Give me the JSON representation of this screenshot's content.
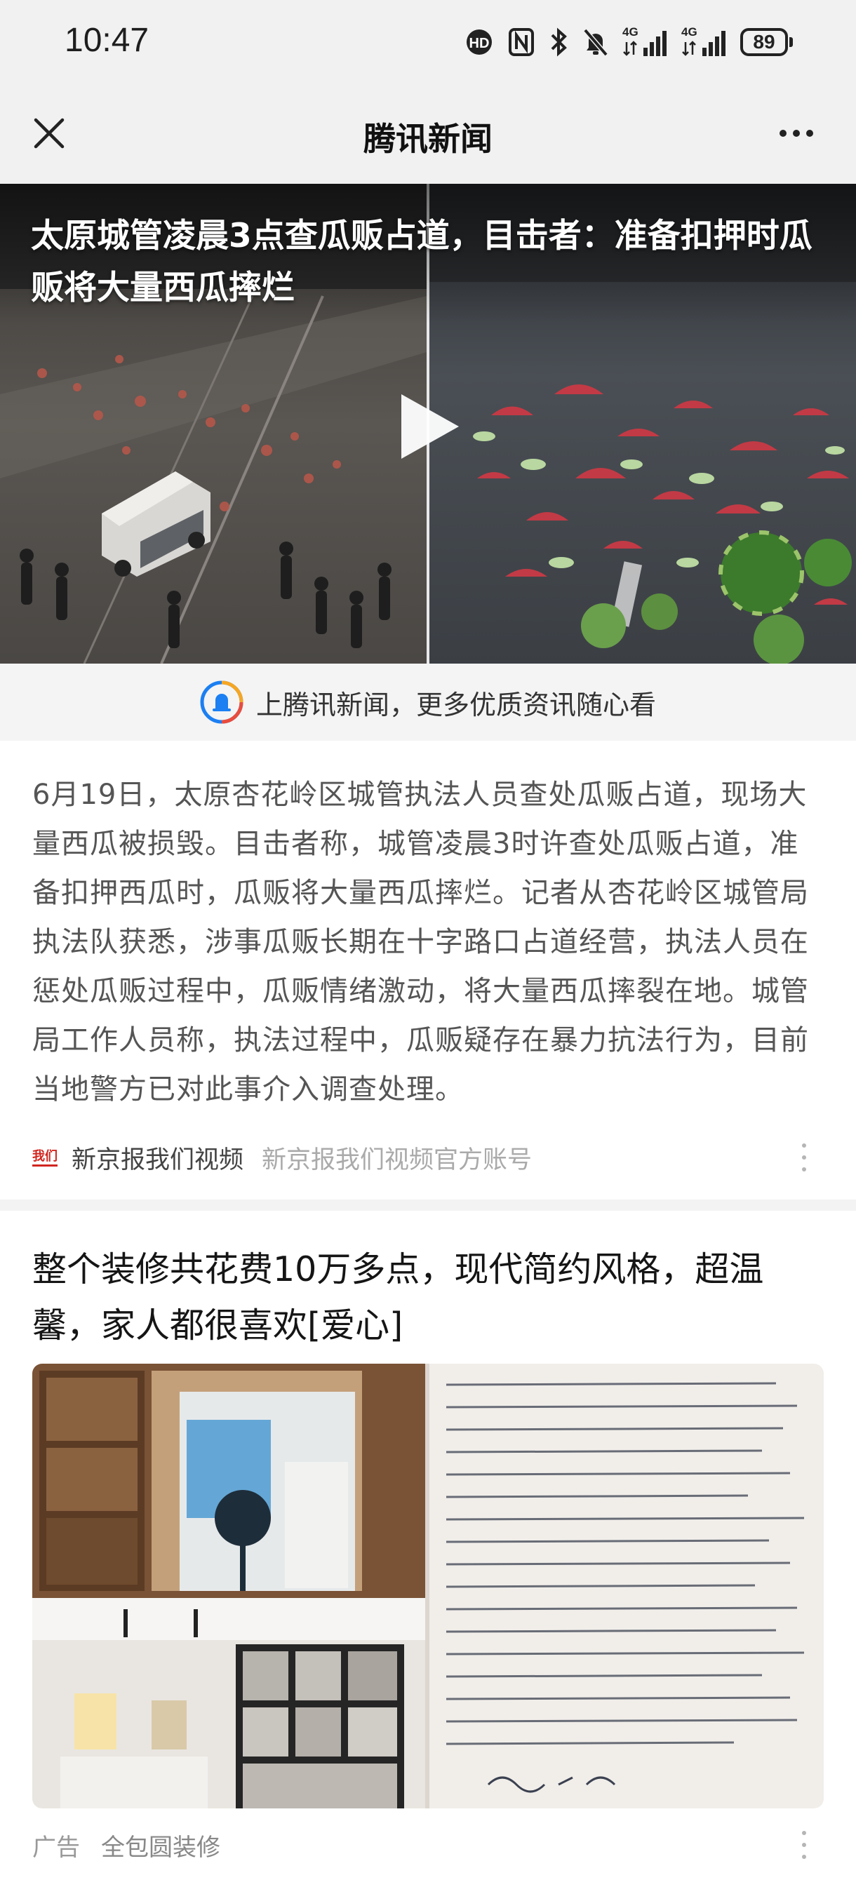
{
  "status_bar": {
    "time": "10:47",
    "signal_1": "4G",
    "signal_2": "4G",
    "battery": "89"
  },
  "header": {
    "title": "腾讯新闻",
    "close_icon": "close-icon",
    "more_icon": "more-dots-icon"
  },
  "video": {
    "title": "太原城管凌晨3点查瓜贩占道，目击者：准备扣押时瓜贩将大量西瓜摔烂",
    "play_icon": "play-icon"
  },
  "promo": {
    "text": "上腾讯新闻，更多优质资讯随心看"
  },
  "article": {
    "body": "6月19日，太原杏花岭区城管执法人员查处瓜贩占道，现场大量西瓜被损毁。目击者称，城管凌晨3时许查处瓜贩占道，准备扣押西瓜时，瓜贩将大量西瓜摔烂。记者从杏花岭区城管局执法队获悉，涉事瓜贩长期在十字路口占道经营，执法人员在惩处瓜贩过程中，瓜贩情绪激动，将大量西瓜摔裂在地。城管局工作人员称，执法过程中，瓜贩疑存在暴力抗法行为，目前当地警方已对此事介入调查处理。",
    "source_logo": "我们",
    "source_name": "新京报我们视频",
    "source_desc": "新京报我们视频官方账号"
  },
  "post2": {
    "title": "整个装修共花费10万多点，现代简约风格，超温馨，家人都很喜欢[爱心]",
    "ad_label": "广告",
    "ad_brand": "全包圆装修"
  },
  "colors": {
    "header_bg": "#f1f1f1",
    "promo_bg": "#f4f4f4",
    "source_logo": "#d1261f"
  }
}
